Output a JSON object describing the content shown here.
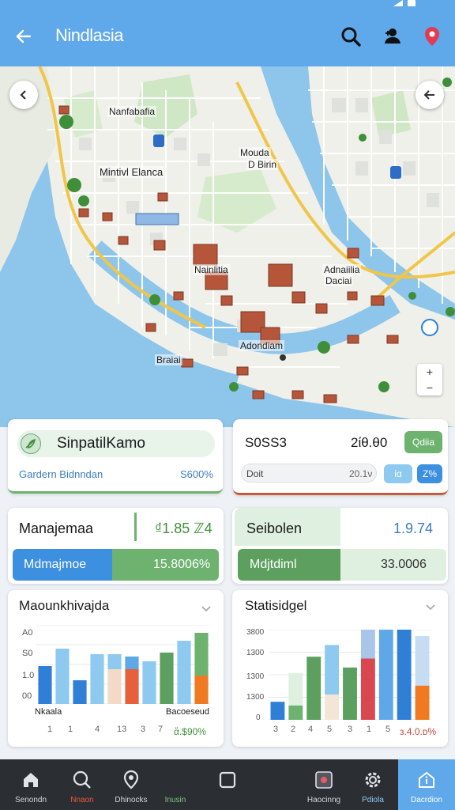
{
  "app_bar": {
    "title": "Nindlasia",
    "back_icon": "arrow-left-icon",
    "icons": [
      "search-icon",
      "user-add-icon",
      "location-pin-icon"
    ]
  },
  "map": {
    "labels": [
      "Nanfabafia",
      "Mouda",
      "D Birin",
      "Mintivl Elanca",
      "Nainlitia",
      "Adnaiilia",
      "Daciai",
      "Braiai",
      "Adondiam"
    ],
    "zoom": {
      "in": "+",
      "out": "−"
    }
  },
  "card_snap": {
    "title": "SinpatilKamo",
    "sub_left": "Gardern Bidnndan",
    "sub_right": "S600%"
  },
  "card_form": {
    "value_a": "S0SS3",
    "value_b": "2ίθ.θ0",
    "badge": "Qdiia",
    "field_label": "Doit",
    "field_value": "20.1ν",
    "btn1": "ία",
    "btn2": "Ζ%"
  },
  "card_manage": {
    "title": "Manajemaa",
    "value": "₫1.85 ℤ4",
    "bar_left": "Mdmajmoe",
    "bar_right": "15.8006%"
  },
  "card_selection": {
    "title": "Seibolen",
    "value": "1.9.74",
    "bar_left": "Mdjtdiml",
    "bar_right": "33.0006"
  },
  "chart_left": {
    "title": "Maounkhivajda",
    "yticks": [
      "A0",
      "S0",
      "1.0",
      "00"
    ],
    "xticks": [
      "1",
      "1",
      "4",
      "13",
      "3",
      "7"
    ],
    "legend_left": "Nkaala",
    "legend_right": "Bacoeseud",
    "footer_right": "ἄ.$90%"
  },
  "chart_right": {
    "title": "Statisidgel",
    "yticks": [
      "3800",
      "1300",
      "1300",
      "1300",
      "0"
    ],
    "xticks": [
      "3",
      "2",
      "4",
      "5",
      "3",
      "1",
      "5"
    ],
    "footer_right": "ᴈ.4.0.ᴅ%"
  },
  "chart_data": [
    {
      "type": "bar",
      "title": "Maounkhivajda",
      "ylim": [
        0,
        100
      ],
      "series": [
        {
          "values": [
            48,
            70,
            30,
            63,
            60,
            54,
            65,
            80,
            90
          ]
        }
      ],
      "stacks": [
        [
          {
            "v": 48,
            "c": "#2f7fd6"
          }
        ],
        [
          {
            "v": 70,
            "c": "#8ec9f0"
          }
        ],
        [
          {
            "v": 30,
            "c": "#2f7fd6"
          }
        ],
        [
          {
            "v": 63,
            "c": "#8ec9f0"
          }
        ],
        [
          {
            "v": 44,
            "c": "#f4d9c6"
          },
          {
            "v": 19,
            "c": "#8ec9f0"
          }
        ],
        [
          {
            "v": 44,
            "c": "#e6603c"
          },
          {
            "v": 16,
            "c": "#5ea8e8"
          }
        ],
        [
          {
            "v": 54,
            "c": "#8ec9f0"
          }
        ],
        [
          {
            "v": 65,
            "c": "#5c9f5e"
          }
        ],
        [
          {
            "v": 80,
            "c": "#8ec9f0"
          }
        ],
        [
          {
            "v": 36,
            "c": "#f07a22"
          },
          {
            "v": 54,
            "c": "#6db36f"
          }
        ]
      ]
    },
    {
      "type": "bar",
      "title": "Statisidgel",
      "ylim": [
        0,
        100
      ],
      "stacks": [
        [
          {
            "v": 20,
            "c": "#2f7fd6"
          }
        ],
        [
          {
            "v": 16,
            "c": "#6db36f"
          },
          {
            "v": 36,
            "c": "#dff0e0"
          }
        ],
        [
          {
            "v": 70,
            "c": "#5c9f5e"
          }
        ],
        [
          {
            "v": 28,
            "c": "#f4e6d6"
          },
          {
            "v": 55,
            "c": "#8ec9f0"
          }
        ],
        [
          {
            "v": 58,
            "c": "#5c9f5e"
          }
        ],
        [
          {
            "v": 68,
            "c": "#d9484f"
          },
          {
            "v": 32,
            "c": "#a9c6ea"
          }
        ],
        [
          {
            "v": 100,
            "c": "#5ea8e8"
          }
        ],
        [
          {
            "v": 100,
            "c": "#2f7fd6"
          }
        ],
        [
          {
            "v": 38,
            "c": "#f07a22"
          },
          {
            "v": 55,
            "c": "#c6dcf2"
          }
        ]
      ]
    }
  ],
  "bottom_nav": [
    {
      "label": "Senondn",
      "icon": "home-icon"
    },
    {
      "label": "Nnaon",
      "icon": "search-icon"
    },
    {
      "label": "Dhinocks",
      "icon": "pin-drop-icon"
    },
    {
      "label": "Inusin",
      "icon": "square-icon"
    },
    {
      "label": "",
      "icon": ""
    },
    {
      "label": "Haocinng",
      "icon": "image-icon"
    },
    {
      "label": "Pdiola",
      "icon": "settings-gear-icon"
    },
    {
      "label": "Dacrdion",
      "icon": "info-home-icon"
    }
  ]
}
